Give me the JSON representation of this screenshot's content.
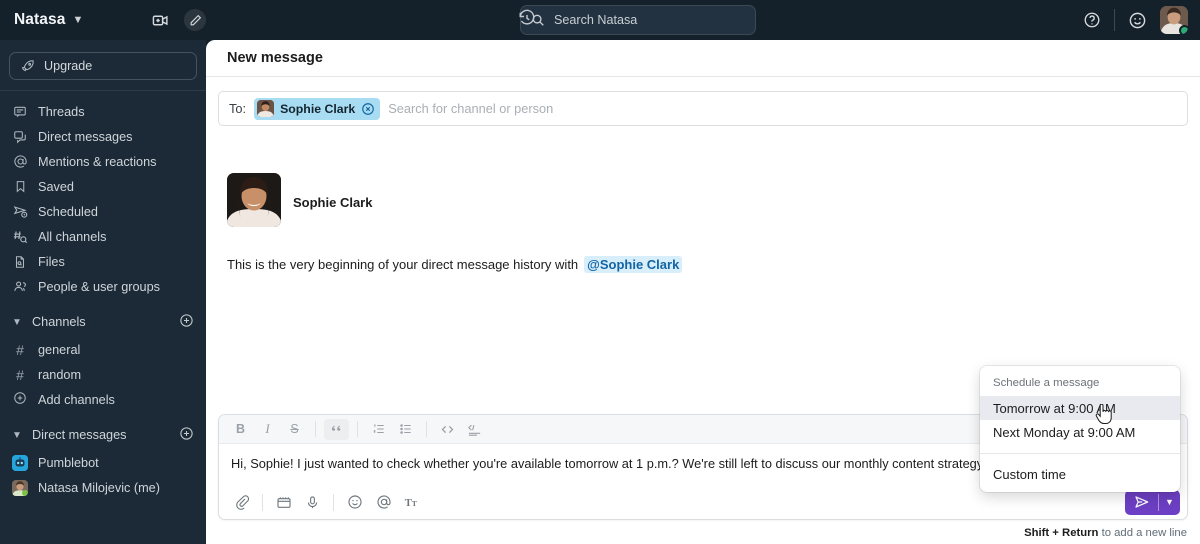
{
  "workspace": {
    "name": "Natasa",
    "caret_icon": "chevron-down-icon",
    "video_icon": "video-camera-icon",
    "compose_icon": "compose-new-message-icon"
  },
  "topbar": {
    "history_icon": "history-clock-icon",
    "search_icon": "search-icon",
    "search_placeholder": "Search Natasa",
    "help_icon": "help-question-icon",
    "status_icon": "emoji-smiley-icon",
    "avatar_name": "avatar",
    "presence": "online"
  },
  "sidebar": {
    "upgrade": {
      "label": "Upgrade",
      "icon": "rocket-icon"
    },
    "nav": [
      {
        "label": "Threads",
        "icon": "threads-icon"
      },
      {
        "label": "Direct messages",
        "icon": "direct-messages-icon"
      },
      {
        "label": "Mentions & reactions",
        "icon": "at-mention-icon"
      },
      {
        "label": "Saved",
        "icon": "bookmark-icon"
      },
      {
        "label": "Scheduled",
        "icon": "scheduled-send-icon"
      },
      {
        "label": "All channels",
        "icon": "all-channels-icon"
      },
      {
        "label": "Files",
        "icon": "files-icon"
      },
      {
        "label": "People & user groups",
        "icon": "people-groups-icon"
      }
    ],
    "channels_section": {
      "label": "Channels",
      "add_icon": "plus-circle-icon",
      "chevron": "chevron-down-icon"
    },
    "channels": [
      {
        "label": "general",
        "prefix": "#"
      },
      {
        "label": "random",
        "prefix": "#"
      }
    ],
    "add_channels": {
      "label": "Add channels",
      "icon": "plus-circle-icon"
    },
    "dms_section": {
      "label": "Direct messages",
      "add_icon": "plus-circle-icon",
      "chevron": "chevron-down-icon"
    },
    "dms": [
      {
        "label": "Pumblebot",
        "avatar": "bot-avatar"
      },
      {
        "label": "Natasa Milojevic (me)",
        "avatar": "user-avatar"
      }
    ]
  },
  "main": {
    "title": "New message",
    "to": {
      "label": "To:",
      "chip_name": "Sophie Clark",
      "chip_remove_icon": "remove-recipient-icon",
      "placeholder": "Search for channel or person"
    },
    "conversation": {
      "sender": "Sophie Clark",
      "intro_text": "This is the very beginning of your direct message history with",
      "mention": "@Sophie Clark"
    }
  },
  "composer": {
    "format_buttons": [
      {
        "name": "bold-icon",
        "glyph": "B"
      },
      {
        "name": "italic-icon",
        "glyph": "I"
      },
      {
        "name": "strikethrough-icon",
        "glyph": "S"
      },
      {
        "name": "blockquote-icon",
        "glyph": "”"
      },
      {
        "name": "ordered-list-icon",
        "glyph": ""
      },
      {
        "name": "bulleted-list-icon",
        "glyph": ""
      },
      {
        "name": "code-icon",
        "glyph": "<>"
      },
      {
        "name": "code-block-icon",
        "glyph": ""
      }
    ],
    "message": "Hi, Sophie! I just wanted to check whether you're available tomorrow at 1 p.m.? We're still left to discuss our monthly content strategy.",
    "action_buttons": [
      {
        "name": "attachment-icon"
      },
      {
        "name": "video-clip-icon"
      },
      {
        "name": "audio-record-icon"
      },
      {
        "name": "emoji-icon"
      },
      {
        "name": "mention-icon"
      },
      {
        "name": "text-formatting-icon"
      }
    ],
    "send_icon": "send-paper-plane-icon",
    "send_caret_icon": "chevron-down-icon",
    "hint_bold": "Shift + Return",
    "hint_rest": " to add a new line"
  },
  "schedule_dropdown": {
    "label": "Schedule a message",
    "options": [
      {
        "label": "Tomorrow at 9:00 AM",
        "hovered": true
      },
      {
        "label": "Next Monday at 9:00 AM",
        "hovered": false
      }
    ],
    "custom": "Custom time"
  },
  "colors": {
    "sidebar_bg": "#1b2a36",
    "topbar_bg": "#14202a",
    "accent_purple": "#6d3fc4",
    "chip_blue": "#a8dcf2",
    "mention_blue": "#1264a3",
    "presence_green": "#2bac76"
  }
}
